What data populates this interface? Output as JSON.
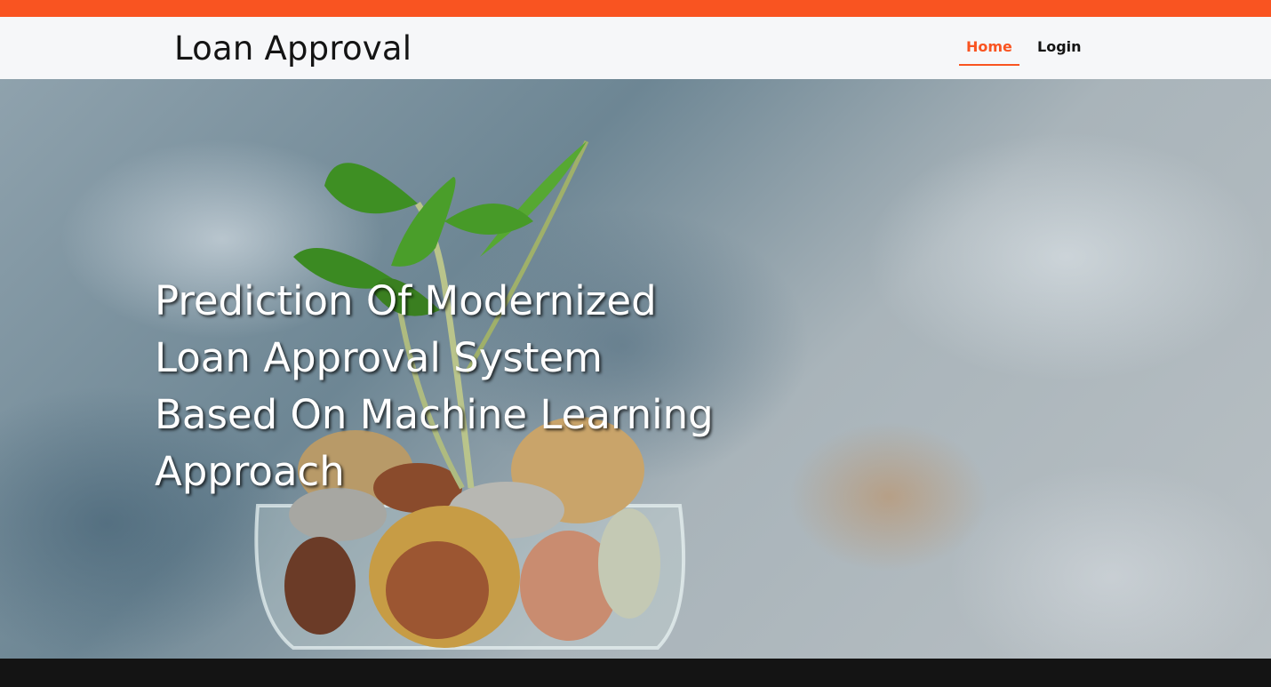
{
  "header": {
    "brand": "Loan Approval",
    "nav": {
      "home_label": "Home",
      "login_label": "Login"
    }
  },
  "hero": {
    "title_lines": [
      "Prediction Of Modernized",
      "Loan Approval System",
      "Based On Machine Learning",
      "Approach"
    ]
  },
  "colors": {
    "accent": "#f95421",
    "navbar_bg": "#f6f7f9",
    "footer_bg": "#141414"
  }
}
